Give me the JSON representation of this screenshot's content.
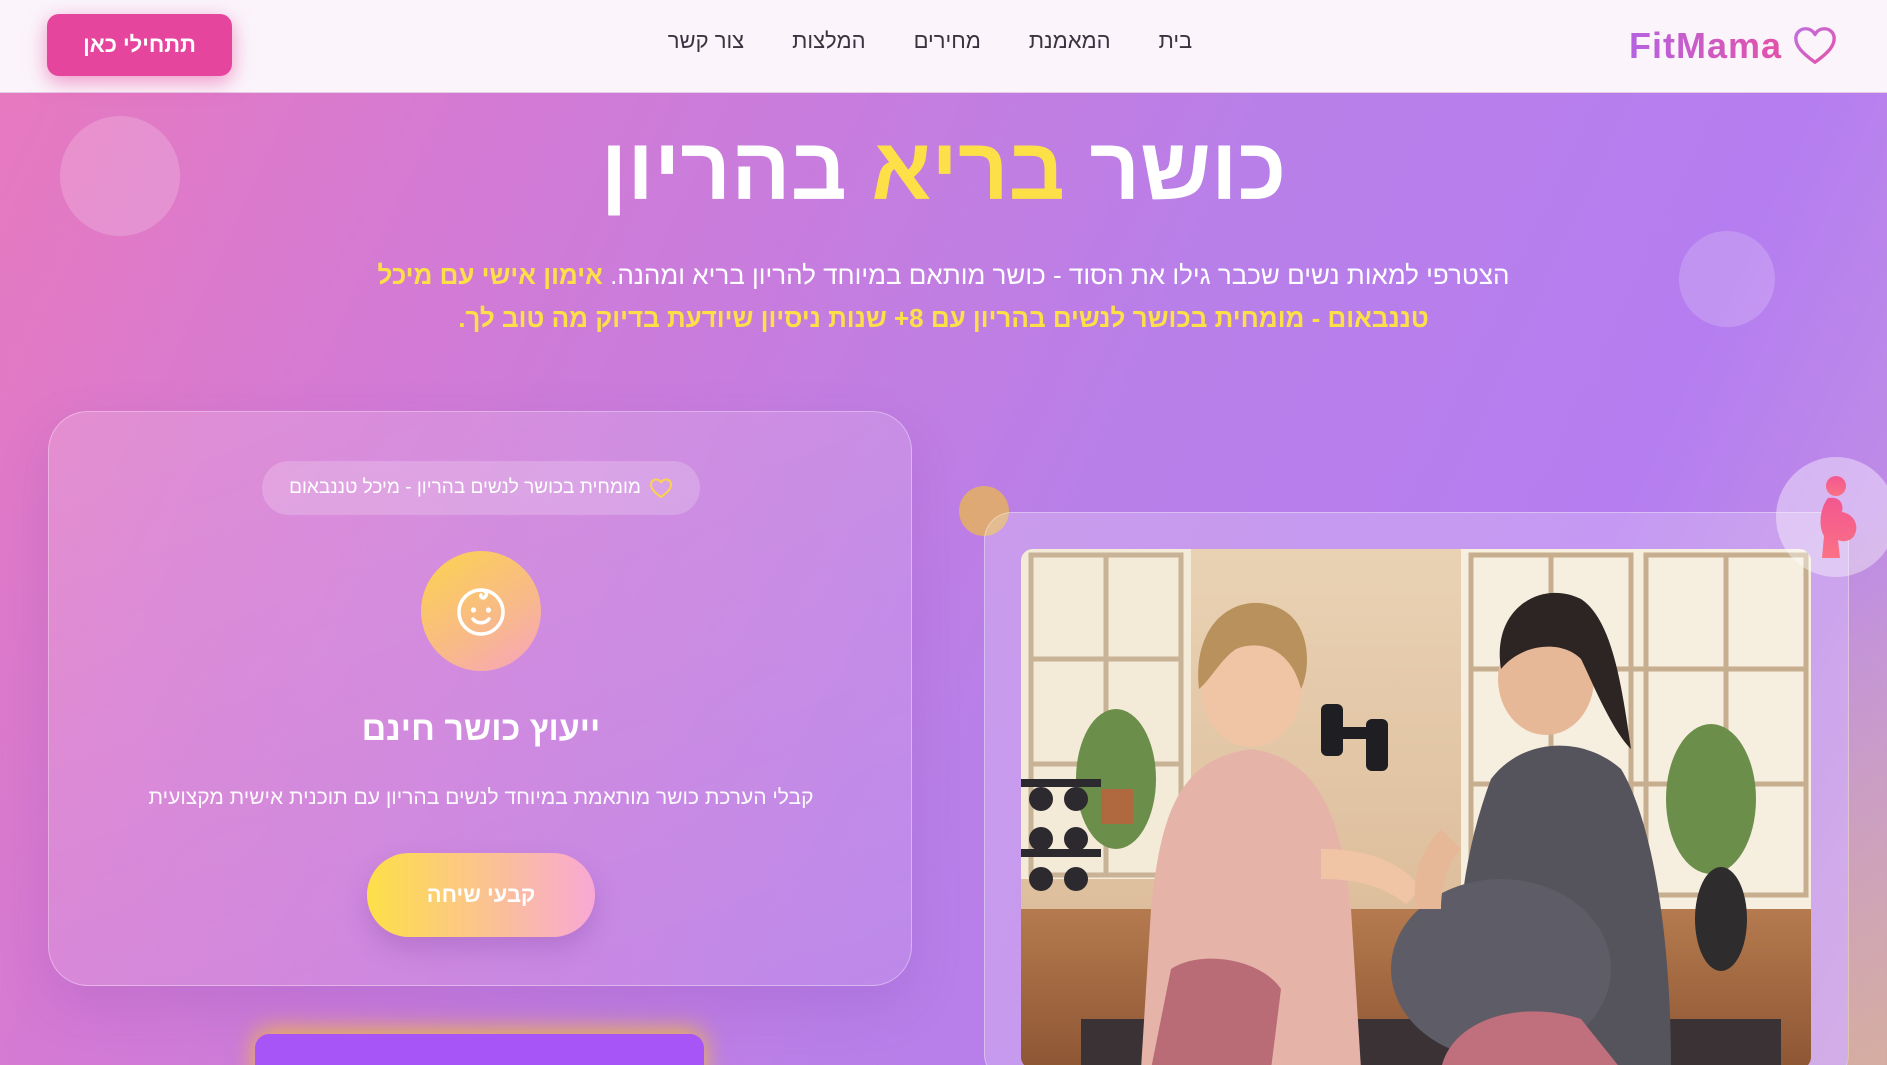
{
  "nav": {
    "brand": "FitMama",
    "links": [
      "בית",
      "המאמנת",
      "מחירים",
      "המלצות",
      "צור קשר"
    ],
    "cta": "תתחילי כאן"
  },
  "hero": {
    "title_part1": "כושר",
    "title_highlight": "בריא",
    "title_part2": "בהריון",
    "subtitle_plain": "הצטרפי למאות נשים שכבר גילו את הסוד - כושר מותאם במיוחד להריון בריא ומהנה.",
    "subtitle_highlight": "אימון אישי עם מיכל טננבאום - מומחית בכושר לנשים בהריון עם 8+ שנות ניסיון שיודעת בדיוק מה טוב לך."
  },
  "card": {
    "badge": "מומחית בכושר לנשים בהריון - מיכל טננבאום",
    "title": "ייעוץ כושר חינם",
    "description": "קבלי הערכת כושר מותאמת במיוחד לנשים בהריון עם תוכנית אישית מקצועית",
    "button": "קבעי שיחה"
  },
  "icons": {
    "brand": "heart-icon",
    "badge": "heart-outline-icon",
    "card": "baby-face-icon",
    "floating": "pregnant-woman-icon"
  },
  "colors": {
    "accent_pink": "#e5459c",
    "highlight_yellow": "#fde047",
    "purple": "#a855f7"
  }
}
